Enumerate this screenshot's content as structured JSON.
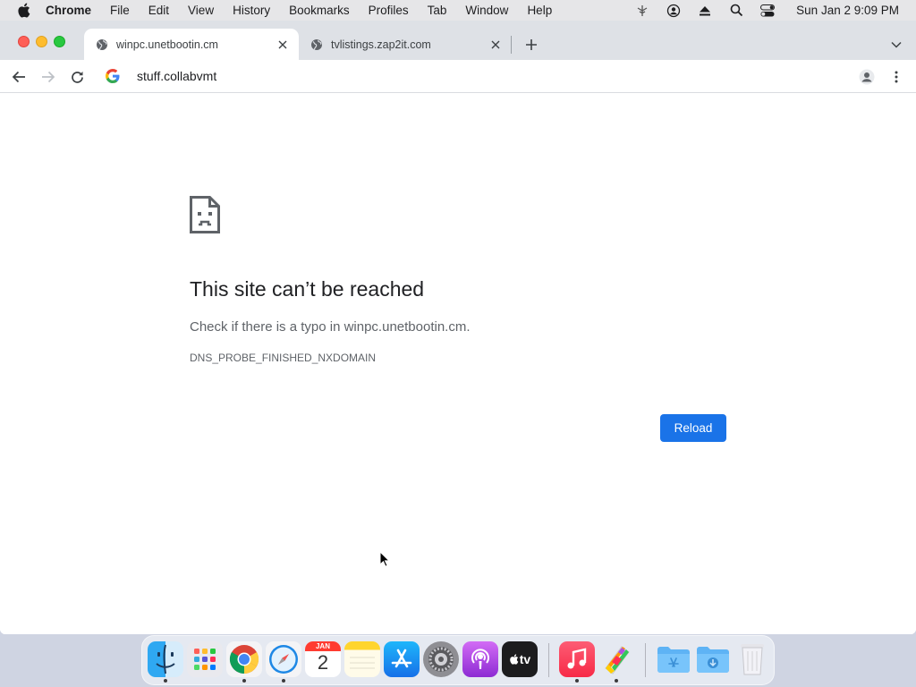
{
  "menubar": {
    "app_name": "Chrome",
    "items": [
      "File",
      "Edit",
      "View",
      "History",
      "Bookmarks",
      "Profiles",
      "Tab",
      "Window",
      "Help"
    ],
    "clock": "Sun Jan 2  9:09 PM"
  },
  "tabs": [
    {
      "title": "winpc.unetbootin.cm",
      "active": true
    },
    {
      "title": "tvlistings.zap2it.com",
      "active": false
    }
  ],
  "omnibox": {
    "text": "stuff.collabvmt"
  },
  "error": {
    "title": "This site can’t be reached",
    "suggestion": "Check if there is a typo in winpc.unetbootin.cm.",
    "code": "DNS_PROBE_FINISHED_NXDOMAIN",
    "reload_label": "Reload"
  },
  "dock": {
    "calendar_month": "JAN",
    "calendar_day": "2",
    "tv_label": "tv",
    "apps": [
      "finder-icon",
      "launchpad-icon",
      "chrome-icon",
      "safari-icon",
      "calendar-icon",
      "notes-icon",
      "app-store-icon",
      "system-preferences-icon",
      "podcasts-icon",
      "apple-tv-icon",
      "music-icon",
      "color-picker-icon",
      "applications-folder-icon",
      "downloads-folder-icon",
      "trash-icon"
    ]
  },
  "colors": {
    "accent": "#1a73e8",
    "tabstrip": "#dee1e6",
    "close": "#fe5f57",
    "minimize": "#febc2e",
    "maximize": "#28c840"
  }
}
